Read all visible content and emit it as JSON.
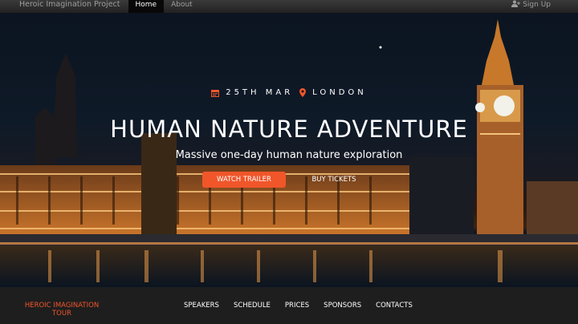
{
  "topnav": {
    "brand": "Heroic Imagination Project",
    "home": "Home",
    "about": "About",
    "signup": "Sign Up"
  },
  "hero": {
    "date": "25TH MAR",
    "location": "LONDON",
    "title": "HUMAN NATURE ADVENTURE",
    "subtitle": "Massive one-day human nature exploration",
    "watch_trailer": "WATCH TRAILER",
    "buy_tickets": "BUY TICKETS"
  },
  "footer": {
    "brand": "HEROIC IMAGINATION TOUR",
    "links": [
      "SPEAKERS",
      "SCHEDULE",
      "PRICES",
      "SPONSORS",
      "CONTACTS"
    ]
  },
  "colors": {
    "accent": "#f0562a",
    "nav_bg": "#222222",
    "footer_bg": "#1e1e1e"
  }
}
